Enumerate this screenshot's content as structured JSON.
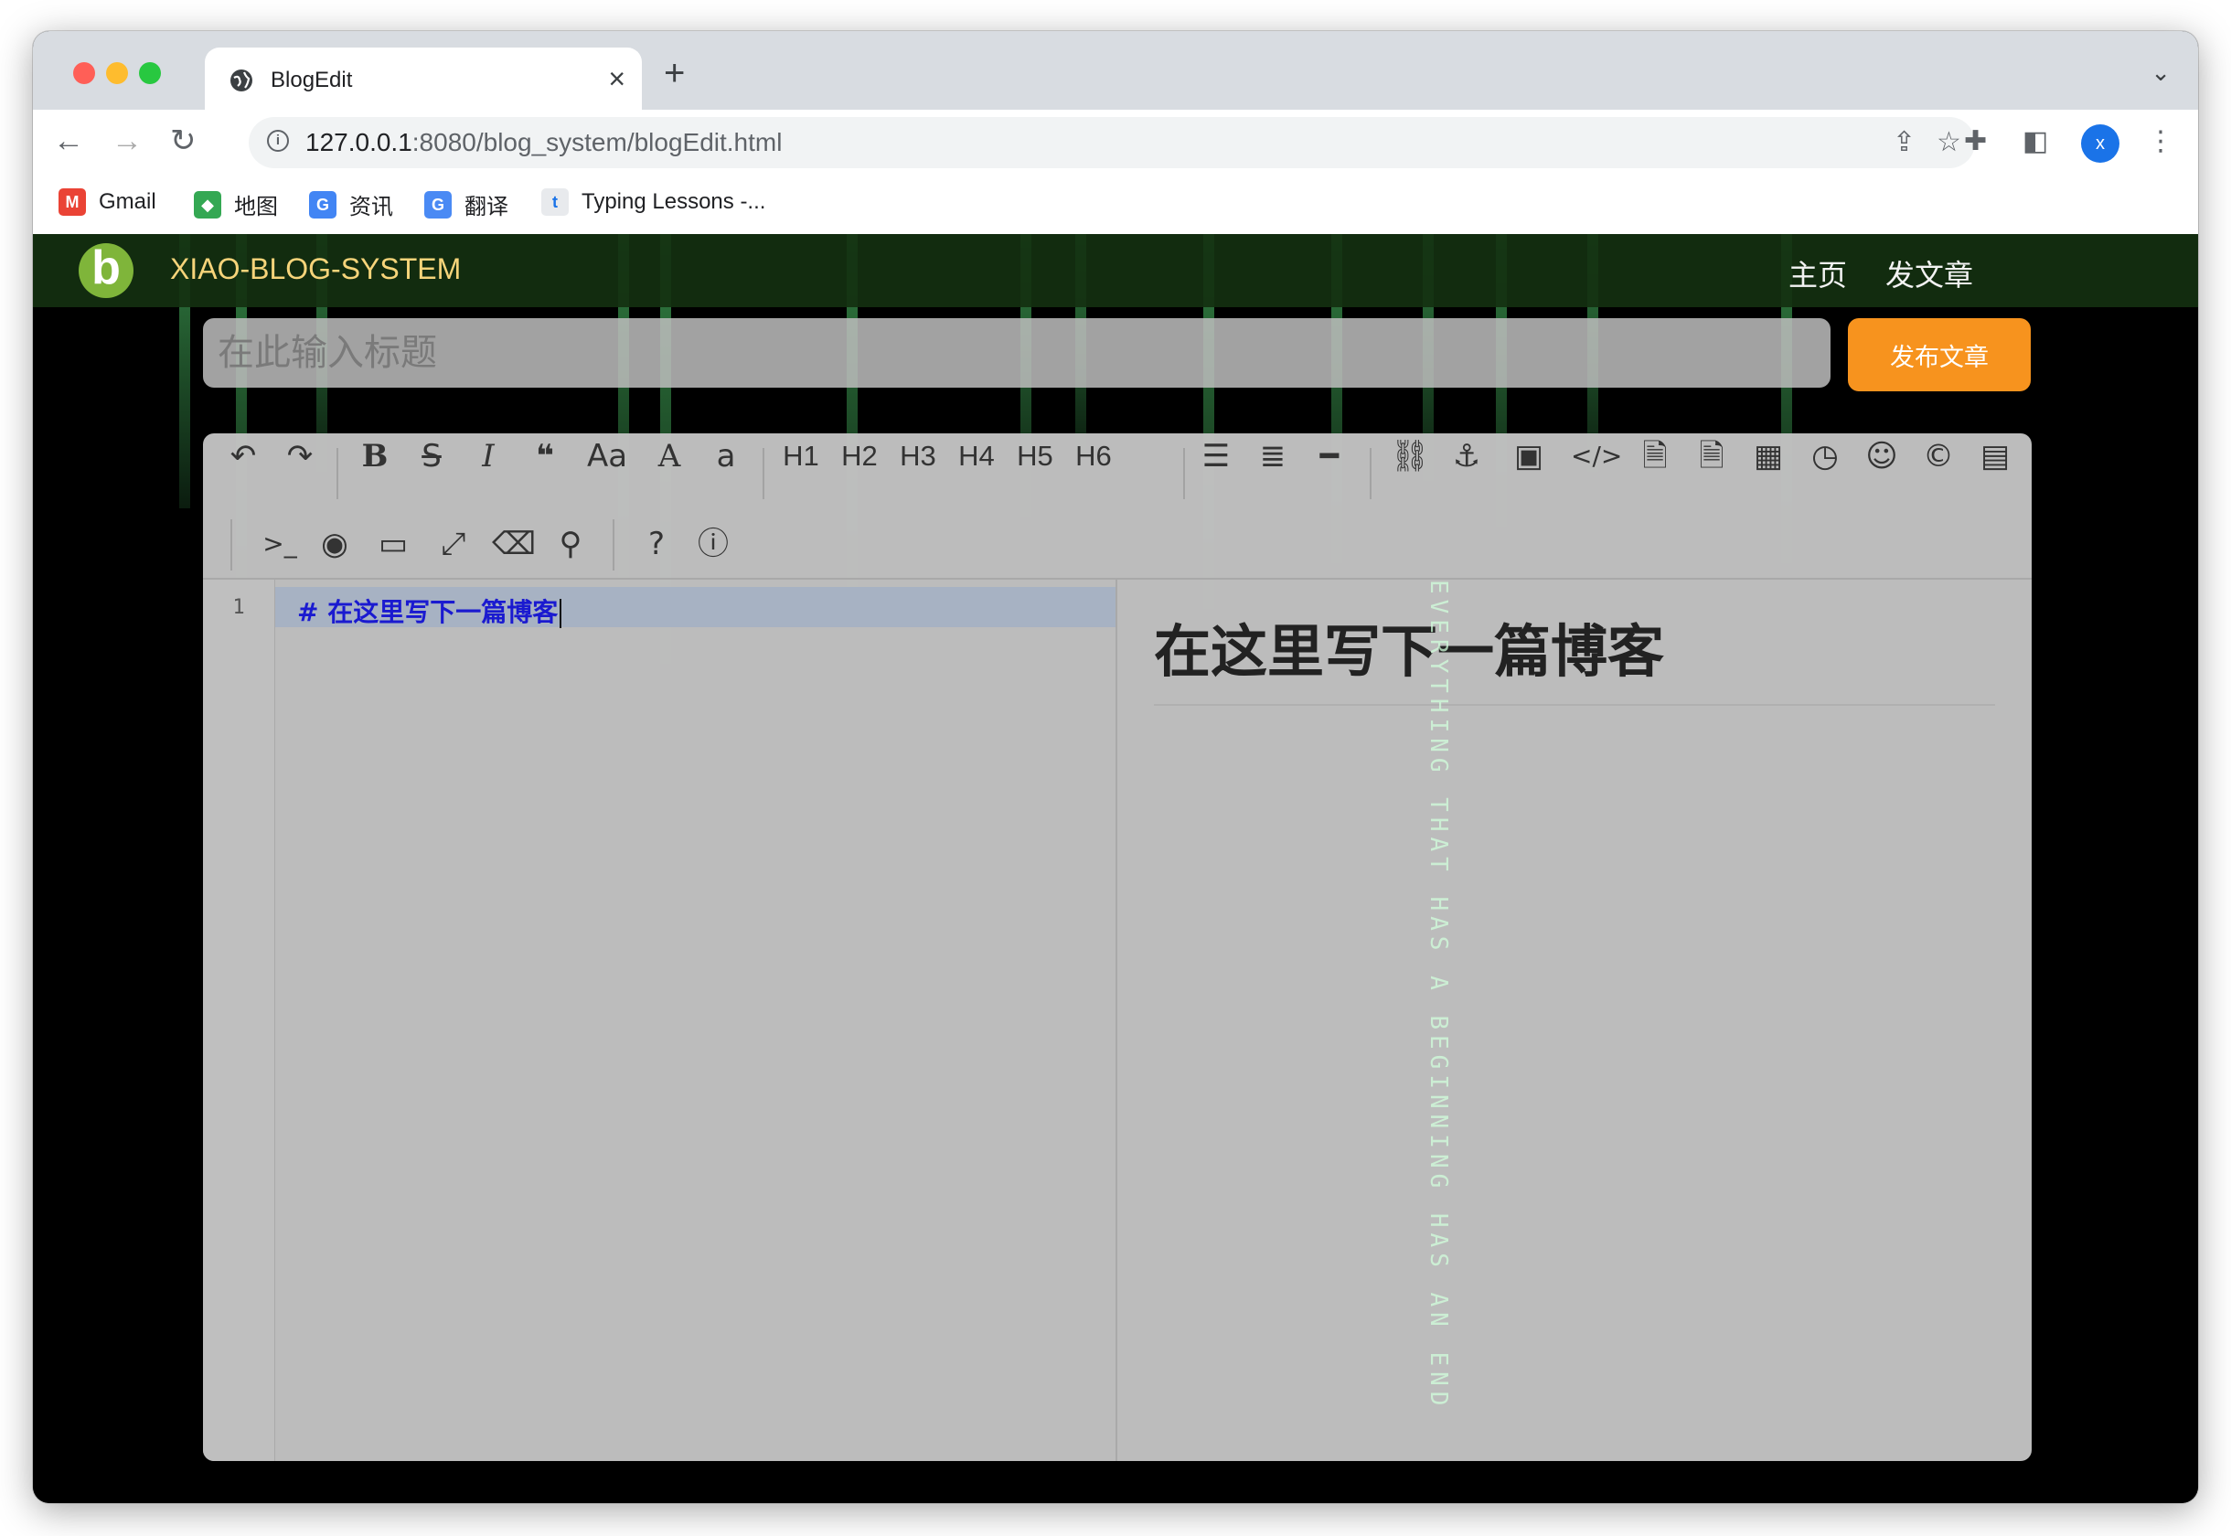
{
  "browser": {
    "tab_title": "BlogEdit",
    "tab_close": "×",
    "new_tab": "+",
    "tab_menu": "⌄",
    "url_host": "127.0.0.1",
    "url_path": ":8080/blog_system/blogEdit.html",
    "avatar_letter": "x",
    "bookmarks": [
      {
        "label": "Gmail",
        "icon": "gmail-icon"
      },
      {
        "label": "地图",
        "icon": "maps-icon"
      },
      {
        "label": "资讯",
        "icon": "news-icon"
      },
      {
        "label": "翻译",
        "icon": "translate-icon"
      },
      {
        "label": "Typing Lessons -...",
        "icon": "typing-icon"
      }
    ]
  },
  "site": {
    "brand": "XIAO-BLOG-SYSTEM",
    "nav_home": "主页",
    "nav_write": "发文章",
    "title_placeholder": "在此输入标题",
    "publish_label": "发布文章",
    "accent_color": "#f7931e",
    "navbar_color": "#143010"
  },
  "editor": {
    "heading_buttons": [
      "H1",
      "H2",
      "H3",
      "H4",
      "H5",
      "H6"
    ],
    "case_button": "Aa",
    "line_number": "1",
    "code_line": "# 在这里写下一篇博客",
    "preview_heading": "在这里写下一篇博客",
    "background_text": "EVERYTHING THAT HAS A BEGINNING HAS AN END"
  }
}
